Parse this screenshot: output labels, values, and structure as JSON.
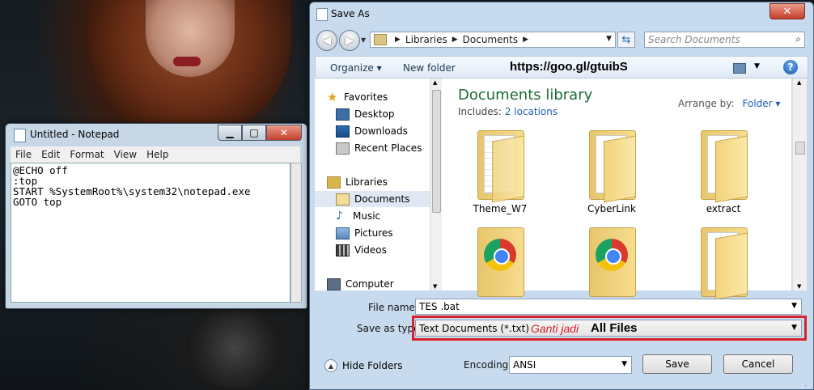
{
  "notepad": {
    "title": "Untitled - Notepad",
    "buttons": {
      "minimize": "▁",
      "maximize": "□",
      "close": "✕"
    },
    "menu": [
      "File",
      "Edit",
      "Format",
      "View",
      "Help"
    ],
    "content": "@ECHO off\n:top\nSTART %SystemRoot%\\system32\\notepad.exe\nGOTO top"
  },
  "dialog": {
    "title": "Save As",
    "close": "✕",
    "address": {
      "parts": [
        "Libraries",
        "Documents"
      ]
    },
    "search_placeholder": "Search Documents",
    "toolbar": {
      "organize": "Organize ▾",
      "new_folder": "New folder",
      "overlay_url": "https://goo.gl/gtuibS"
    },
    "left_pane": {
      "items": [
        {
          "label": "Favorites",
          "icon": "star-icon",
          "color": "#e0a51f"
        },
        {
          "label": "Desktop",
          "icon": "desktop-icon",
          "color": "#3a6ea5"
        },
        {
          "label": "Downloads",
          "icon": "downloads-icon",
          "color": "#2e6db4"
        },
        {
          "label": "Recent Places",
          "icon": "recent-places-icon",
          "color": "#8a8a8a"
        },
        {
          "label": "Libraries",
          "icon": "libraries-icon",
          "color": "#d9b44a"
        },
        {
          "label": "Documents",
          "icon": "documents-icon",
          "color": "#d9c586"
        },
        {
          "label": "Music",
          "icon": "music-icon",
          "color": "#3a6ea5"
        },
        {
          "label": "Pictures",
          "icon": "pictures-icon",
          "color": "#5b86b8"
        },
        {
          "label": "Videos",
          "icon": "videos-icon",
          "color": "#3d3d3d"
        },
        {
          "label": "Computer",
          "icon": "computer-icon",
          "color": "#5e6e82"
        }
      ],
      "selected": "Documents"
    },
    "library": {
      "title": "Documents library",
      "includes_label": "Includes:",
      "includes_link": "2 locations",
      "arrange_label": "Arrange by:",
      "arrange_value": "Folder ▾"
    },
    "folders": [
      {
        "name": "Theme_W7",
        "kind": "doc"
      },
      {
        "name": "CyberLink",
        "kind": "plain"
      },
      {
        "name": "extract",
        "kind": "plain"
      },
      {
        "name": "",
        "kind": "chrome"
      },
      {
        "name": "",
        "kind": "chrome"
      },
      {
        "name": "",
        "kind": "plain"
      }
    ],
    "file_name_label": "File name:",
    "file_name_value": "TES .bat",
    "save_type_label": "Save as type:",
    "save_type_value": "Text Documents (*.txt)",
    "annotation_red": "Ganti jadi",
    "annotation_bold": "All Files",
    "hide_folders": "Hide Folders",
    "encoding_label": "Encoding:",
    "encoding_value": "ANSI",
    "save_button": "Save",
    "cancel_button": "Cancel"
  },
  "colors": {
    "accent_red": "#d9222a",
    "library_title": "#1c6b33",
    "link_blue": "#1f5fb0"
  }
}
